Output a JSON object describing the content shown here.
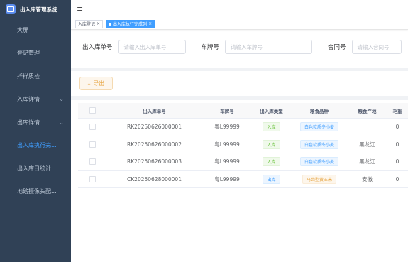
{
  "app": {
    "title": "出入库管理系统"
  },
  "sidebar": {
    "items": [
      {
        "label": "大屏"
      },
      {
        "label": "登记管理"
      },
      {
        "label": "扦样质检"
      },
      {
        "label": "入库详情"
      },
      {
        "label": "出库详情"
      },
      {
        "label": "出入库执行完..."
      },
      {
        "label": "出入库日统计..."
      },
      {
        "label": "地磅摄像头配..."
      }
    ]
  },
  "tabs": [
    {
      "label": "入库登记"
    },
    {
      "label": "出入库执行完成列"
    }
  ],
  "filters": [
    {
      "label": "出入库单号",
      "placeholder": "请输入出入库单号"
    },
    {
      "label": "车牌号",
      "placeholder": "请输入车牌号"
    },
    {
      "label": "合同号",
      "placeholder": "请输入合同号"
    }
  ],
  "toolbar": {
    "export_label": "导出",
    "export_icon": "⤓"
  },
  "table": {
    "headers": [
      "出入库单号",
      "车牌号",
      "出入库类型",
      "粮食品种",
      "粮食产地",
      "毛重"
    ],
    "rows": [
      {
        "order_no": "RK20250626000001",
        "plate": "粤L99999",
        "type": "入库",
        "grain": "白色软质冬小麦",
        "origin": "",
        "gross": "0"
      },
      {
        "order_no": "RK20250626000002",
        "plate": "粤L99999",
        "type": "入库",
        "grain": "白色软质冬小麦",
        "origin": "黑龙江",
        "gross": "0"
      },
      {
        "order_no": "RK20250626000003",
        "plate": "粤L99999",
        "type": "入库",
        "grain": "白色软质冬小麦",
        "origin": "黑龙江",
        "gross": "0"
      },
      {
        "order_no": "CK20250628000001",
        "plate": "粤L99999",
        "type": "出库",
        "grain": "马齿型黄玉米",
        "origin": "安徽",
        "gross": "0"
      }
    ]
  }
}
